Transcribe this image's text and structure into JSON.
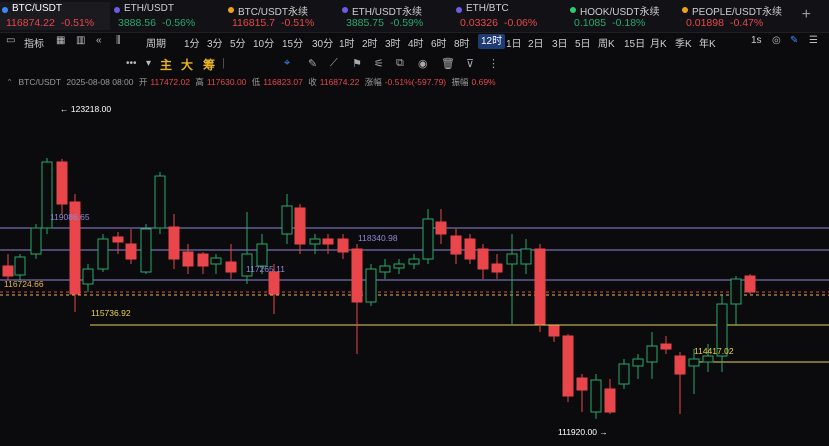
{
  "tabs": [
    {
      "name": "BTC/USDT",
      "price": "116874.22",
      "change": "-0.51%",
      "dir": "down",
      "dot": "#3a8bff",
      "active": true
    },
    {
      "name": "ETH/USDT",
      "price": "3888.56",
      "change": "-0.56%",
      "dir": "up",
      "dot": "#6c5ce7"
    },
    {
      "name": "BTC/USDT永续",
      "price": "116815.7",
      "change": "-0.51%",
      "dir": "down",
      "dot": "#f0a020"
    },
    {
      "name": "ETH/USDT永续",
      "price": "3885.75",
      "change": "-0.59%",
      "dir": "up",
      "dot": "#6c5ce7"
    },
    {
      "name": "ETH/BTC",
      "price": "0.03326",
      "change": "-0.06%",
      "dir": "down",
      "dot": "#6c5ce7"
    },
    {
      "name": "HOOK/USDT永续",
      "price": "0.1085",
      "change": "-0.18%",
      "dir": "up",
      "dot": "#2ecc71"
    },
    {
      "name": "PEOPLE/USDT永续",
      "price": "0.01898",
      "change": "-0.47%",
      "dir": "down",
      "dot": "#f0a020"
    }
  ],
  "toolbar": {
    "indicator_label": "指标",
    "period_label": "周期",
    "intervals": [
      "1分",
      "3分",
      "5分",
      "10分",
      "15分",
      "30分",
      "1时",
      "2时",
      "3时",
      "4时",
      "6时",
      "8时",
      "12时",
      "1日",
      "2日",
      "3日",
      "5日",
      "周K",
      "15日",
      "月K",
      "季K",
      "年K"
    ],
    "selected_interval": "12时",
    "seconds_label": "1s"
  },
  "drawtools": {
    "zhu": "主",
    "da": "大",
    "chou": "筹"
  },
  "ohlc": {
    "symbol": "BTC/USDT",
    "time": "2025-08-08 08:00",
    "open_label": "开",
    "open": "117472.02",
    "high_label": "高",
    "high": "117630.00",
    "low_label": "低",
    "low": "116823.07",
    "close_label": "收",
    "close": "116874.22",
    "chg_label": "涨幅",
    "chg": "-0.51%(-597.79)",
    "amp_label": "振幅",
    "amp": "0.69%"
  },
  "chart_data": {
    "type": "candlestick",
    "high_marker": "123218.00",
    "low_marker": "111920.00",
    "levels": [
      {
        "label": "119086.65",
        "color": "#8f86d8"
      },
      {
        "label": "118340.98",
        "color": "#8f86d8"
      },
      {
        "label": "117265.11",
        "color": "#8f86d8"
      },
      {
        "label": "116724.66",
        "color": "#e8b84a"
      },
      {
        "label": "115736.92",
        "color": "#e8d24a"
      },
      {
        "label": "114417.02",
        "color": "#e8d24a"
      }
    ],
    "colors": {
      "up": "#27a96b",
      "down": "#e8464b"
    }
  }
}
